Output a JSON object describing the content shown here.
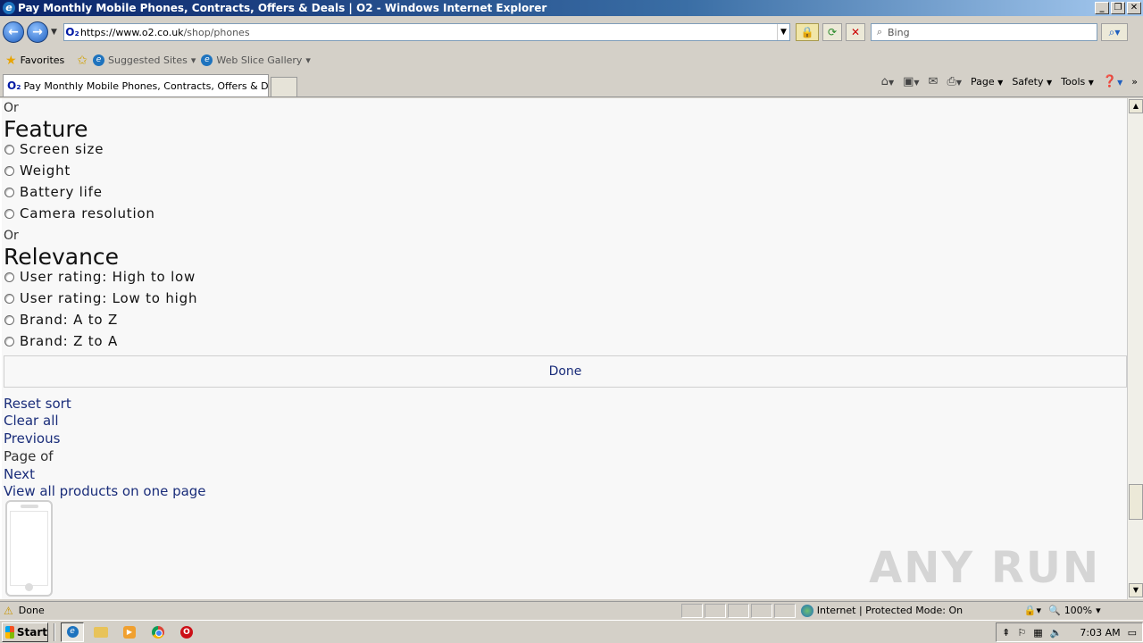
{
  "window": {
    "title": "Pay Monthly Mobile Phones, Contracts, Offers & Deals | O2 - Windows Internet Explorer"
  },
  "address": {
    "url_host": "https://www.o2.co.uk",
    "url_path": "/shop/phones",
    "search_placeholder": "Bing"
  },
  "favorites": {
    "favorites_label": "Favorites",
    "suggested_sites": "Suggested Sites",
    "web_slice_gallery": "Web Slice Gallery"
  },
  "tab": {
    "label": "Pay Monthly Mobile Phones, Contracts, Offers & Deal..."
  },
  "command_bar": {
    "page": "Page",
    "safety": "Safety",
    "tools": "Tools"
  },
  "content": {
    "or_1": "Or",
    "feature_heading": "Feature",
    "feature_options": [
      "Screen size",
      "Weight",
      "Battery life",
      "Camera resolution"
    ],
    "or_2": "Or",
    "relevance_heading": "Relevance",
    "relevance_options": [
      "User rating: High to low",
      "User rating: Low to high",
      "Brand: A to Z",
      "Brand: Z to A"
    ],
    "done_label": "Done",
    "reset_sort": "Reset sort",
    "clear_all": "Clear all",
    "previous": "Previous",
    "page_of": "Page of",
    "next": "Next",
    "view_all": "View all products on one page",
    "watermark": "ANY RUN"
  },
  "status": {
    "text": "Done",
    "zone": "Internet | Protected Mode: On",
    "zoom": "100%"
  },
  "taskbar": {
    "start": "Start",
    "clock": "7:03 AM"
  }
}
